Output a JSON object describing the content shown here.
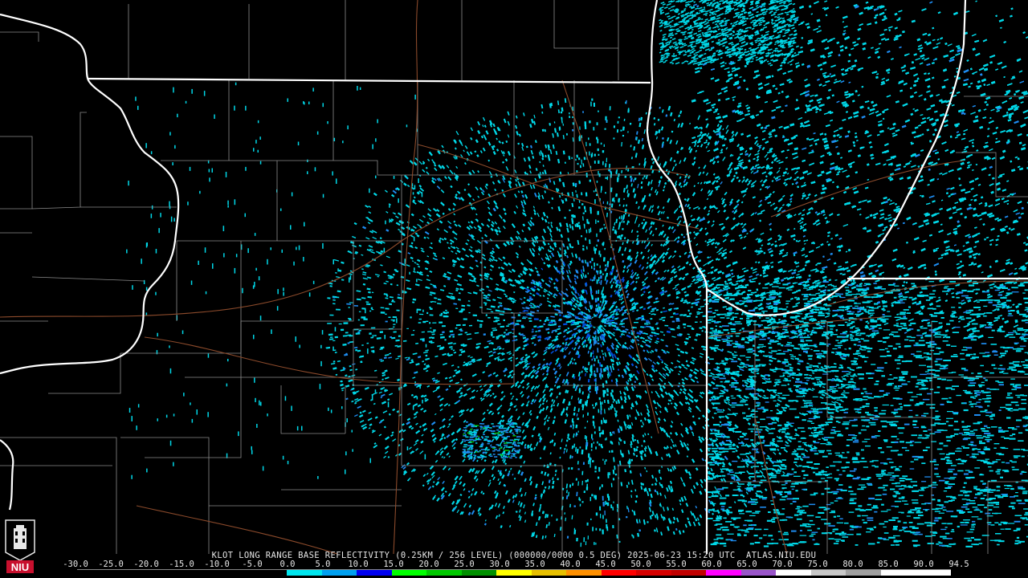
{
  "radar": {
    "station": "KLOT",
    "caption": "KLOT LONG RANGE BASE REFLECTIVITY (0.25KM / 256 LEVEL) (000000/0000 0.5 DEG) 2025-06-23 15:20 UTC  ATLAS.NIU.EDU",
    "scale_ticks": [
      "-30.0",
      "-25.0",
      "-20.0",
      "-15.0",
      "-10.0",
      "-5.0",
      "0.0",
      "5.0",
      "10.0",
      "15.0",
      "20.0",
      "25.0",
      "30.0",
      "35.0",
      "40.0",
      "45.0",
      "50.0",
      "55.0",
      "60.0",
      "65.0",
      "70.0",
      "75.0",
      "80.0",
      "85.0",
      "90.0",
      "94.5"
    ],
    "scale_colors": [
      "#000000",
      "#000000",
      "#000000",
      "#000000",
      "#000000",
      "#000000",
      "#00e5ee",
      "#00a0f0",
      "#0000f0",
      "#00ff00",
      "#00c800",
      "#009000",
      "#ffff00",
      "#e7c000",
      "#ff9000",
      "#ff0000",
      "#d60000",
      "#c00000",
      "#ff00ff",
      "#9955c9",
      "#ffffff",
      "#c8c8c8",
      "#a0a0a0",
      "#ffffff",
      "#ffffff"
    ],
    "colors": {
      "background": "#000000",
      "state_border": "#ffffff",
      "county_border": "#8c8c8c",
      "highway": "#8b4a2b",
      "echo_light": "#00d8e8",
      "echo_mid": "#1e8cf0",
      "echo_dense": "#0050e0",
      "echo_green": "#00c000",
      "radar_site": "#000000"
    }
  },
  "logo": {
    "text": "NIU",
    "color": "#c8102e"
  }
}
